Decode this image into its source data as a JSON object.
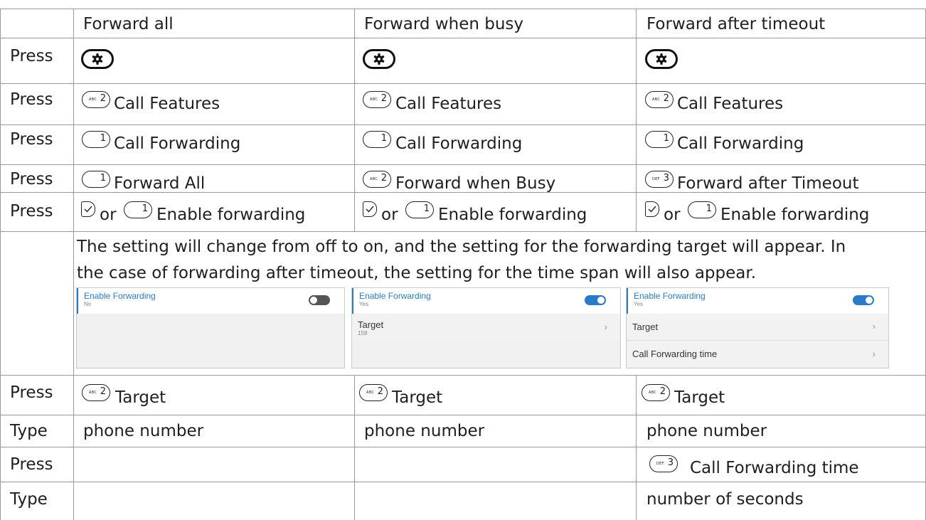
{
  "header": {
    "col1": "Forward all",
    "col2": "Forward when busy",
    "col3": "Forward after timeout"
  },
  "labels": {
    "press": "Press",
    "type": "Type"
  },
  "row_features": {
    "key_sub": "ABC",
    "key_num": "2",
    "text": "Call Features"
  },
  "row_forwarding": {
    "key_num": "1",
    "text": "Call Forwarding"
  },
  "row_mode": {
    "col1": {
      "key_sub": "",
      "key_num": "1",
      "text": "Forward All"
    },
    "col2": {
      "key_sub": "ABC",
      "key_num": "2",
      "text": "Forward when Busy"
    },
    "col3": {
      "key_sub": "DEF",
      "key_num": "3",
      "text": "Forward after Timeout"
    }
  },
  "row_enable": {
    "or": "or",
    "key_num": "1",
    "text": "Enable forwarding"
  },
  "explain": {
    "line1": "The setting will change from off to on, and the setting for the forwarding target will appear.  In",
    "line2": "the case of forwarding after timeout, the setting for the time span will also appear."
  },
  "screens": {
    "s1": {
      "title": "Enable Forwarding",
      "value": "No",
      "toggle": "off"
    },
    "s2": {
      "title": "Enable Forwarding",
      "value": "Yes",
      "toggle": "on",
      "target_label": "Target",
      "target_value": "159"
    },
    "s3": {
      "title": "Enable Forwarding",
      "value": "Yes",
      "toggle": "on",
      "target_label": "Target",
      "time_label": "Call Forwarding time"
    }
  },
  "row_target": {
    "key_sub": "ABC",
    "key_num": "2",
    "text": "Target"
  },
  "row_phone": {
    "text": "phone number"
  },
  "row_time": {
    "key_sub": "DEF",
    "key_num": "3",
    "text": "Call Forwarding time"
  },
  "row_seconds": {
    "text": "number of seconds"
  },
  "colors": {
    "accent": "#2b7ac9",
    "toggle_off": "#555555",
    "grid": "#9a9a9a"
  },
  "icons": {
    "settings": "gear-icon",
    "check": "check-softkey-icon"
  }
}
